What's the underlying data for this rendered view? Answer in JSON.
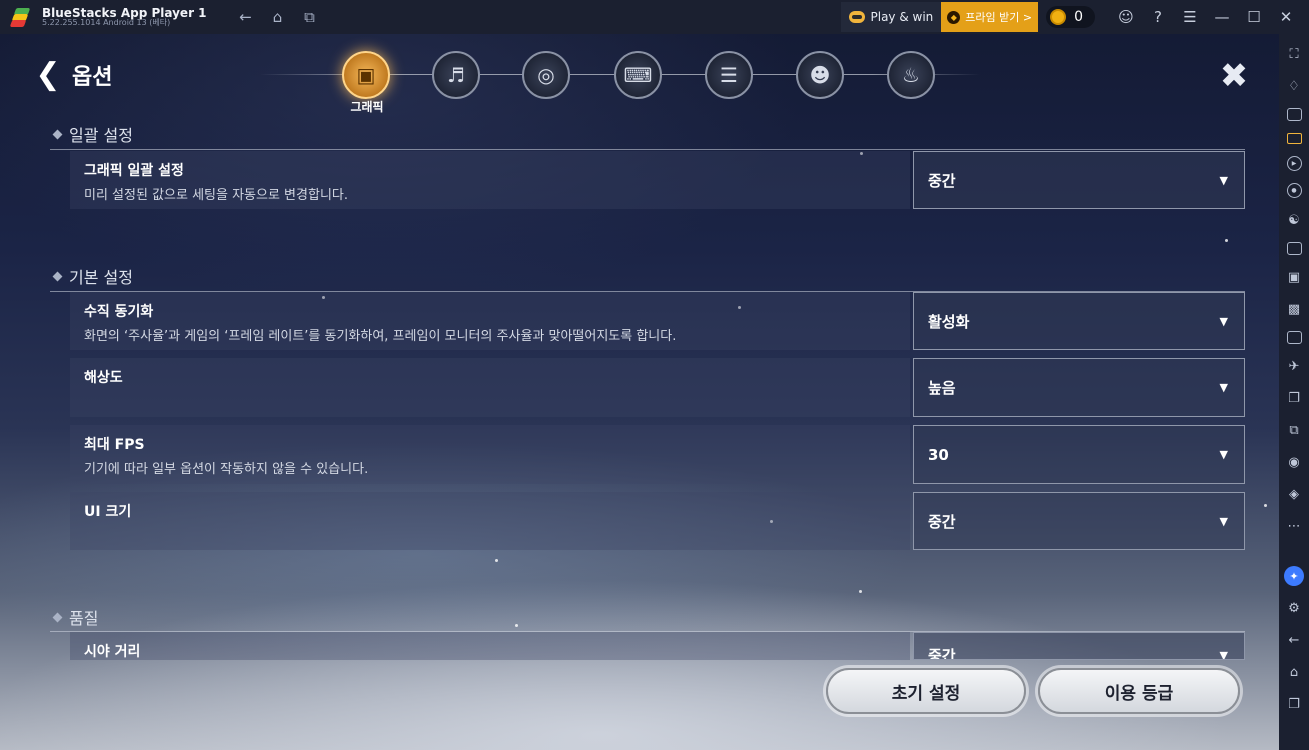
{
  "titlebar": {
    "app_name": "BlueStacks App Player 1",
    "version": "5.22.255.1014  Android 13 (베타)",
    "play_win": "Play & win",
    "premium": "프라임 받기 >",
    "coin_count": "0"
  },
  "game": {
    "title": "옵션",
    "active_tab_label": "그래픽",
    "tabs": [
      "그래픽",
      "사운드",
      "언어",
      "키보드",
      "조작",
      "계정",
      "알림"
    ],
    "sections": [
      {
        "title": "일괄 설정"
      },
      {
        "title": "기본 설정"
      },
      {
        "title": "품질"
      }
    ],
    "settings": [
      {
        "label": "그래픽 일괄 설정",
        "desc": "미리 설정된 값으로 세팅을 자동으로 변경합니다.",
        "value": "중간"
      },
      {
        "label": "수직 동기화",
        "desc": "화면의 ‘주사율’과 게임의 ‘프레임 레이트’를 동기화하여, 프레임이 모니터의 주사율과 맞아떨어지도록 합니다.",
        "value": "활성화"
      },
      {
        "label": "해상도",
        "desc": "",
        "value": "높음"
      },
      {
        "label": "최대 FPS",
        "desc": "기기에 따라 일부 옵션이 작동하지 않을 수 있습니다.",
        "value": "30"
      },
      {
        "label": "UI 크기",
        "desc": "",
        "value": "중간"
      },
      {
        "label": "시야 거리",
        "desc": "",
        "value": "중간"
      }
    ],
    "buttons": {
      "reset": "초기 설정",
      "rating": "이용 등급"
    }
  },
  "icons": {
    "dropdown_arrow": "▼"
  }
}
